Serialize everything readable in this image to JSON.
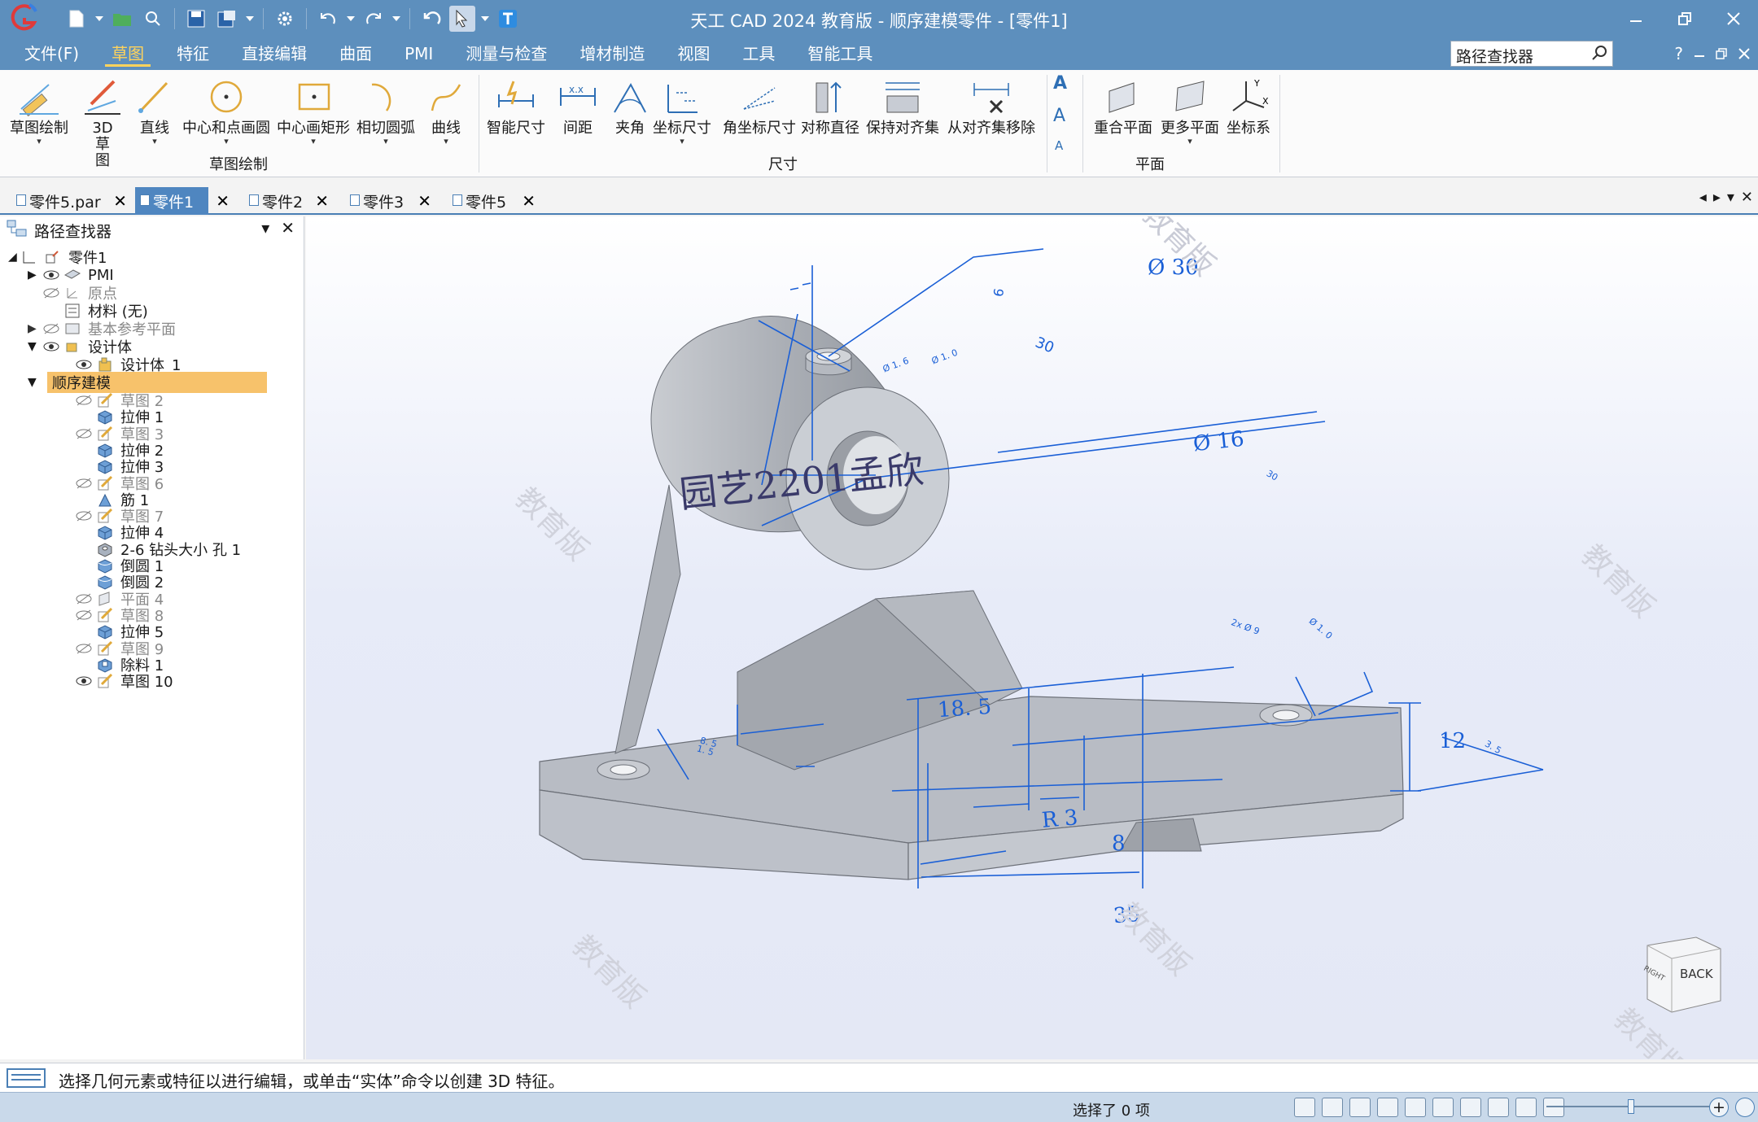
{
  "window": {
    "title": "天工 CAD 2024 教育版 - 顺序建模零件 - [零件1]",
    "accent": "#5d8fbd",
    "controls": [
      "minimize",
      "restore",
      "close"
    ]
  },
  "menubar": {
    "items": [
      "文件(F)",
      "草图",
      "特征",
      "直接编辑",
      "曲面",
      "PMI",
      "测量与检查",
      "增材制造",
      "视图",
      "工具",
      "智能工具"
    ],
    "active_index": 1,
    "search_value": "路径查找器",
    "help": "?"
  },
  "ribbon": {
    "groups": [
      {
        "title": "草图绘制",
        "buttons": [
          "草图绘制",
          "3D 草图",
          "直线",
          "中心和点画圆",
          "中心画矩形",
          "相切圆弧",
          "曲线"
        ]
      },
      {
        "title": "尺寸",
        "buttons": [
          "智能尺寸",
          "间距",
          "夹角",
          "坐标尺寸",
          "角坐标尺寸",
          "对称直径",
          "保持对齐集",
          "从对齐集移除"
        ]
      },
      {
        "title": "平面",
        "buttons": [
          "重合平面",
          "更多平面",
          "坐标系"
        ]
      }
    ],
    "text_buttons": [
      "A",
      "A",
      "A"
    ]
  },
  "tabs": {
    "items": [
      "零件5.par",
      "零件1",
      "零件2",
      "零件3",
      "零件5"
    ],
    "active_index": 1
  },
  "pathfinder": {
    "title": "路径查找器",
    "tree": [
      {
        "label": "零件1",
        "level": 0
      },
      {
        "label": "PMI",
        "level": 1
      },
      {
        "label": "原点",
        "level": 1
      },
      {
        "label": "材料 (无)",
        "level": 1
      },
      {
        "label": "基本参考平面",
        "level": 1
      },
      {
        "label": "设计体",
        "level": 1
      },
      {
        "label": "设计体_1",
        "level": 2
      },
      {
        "label": "顺序建模",
        "level": 1
      },
      {
        "label": "草图 2",
        "level": 2
      },
      {
        "label": "拉伸 1",
        "level": 2
      },
      {
        "label": "草图 3",
        "level": 2
      },
      {
        "label": "拉伸 2",
        "level": 2
      },
      {
        "label": "拉伸 3",
        "level": 2
      },
      {
        "label": "草图 6",
        "level": 2
      },
      {
        "label": "筋 1",
        "level": 2
      },
      {
        "label": "草图 7",
        "level": 2
      },
      {
        "label": "拉伸 4",
        "level": 2
      },
      {
        "label": "2-6 钻头大小 孔 1",
        "level": 2
      },
      {
        "label": "倒圆 1",
        "level": 2
      },
      {
        "label": "倒圆 2",
        "level": 2
      },
      {
        "label": "平面 4",
        "level": 2
      },
      {
        "label": "草图 8",
        "level": 2
      },
      {
        "label": "拉伸 5",
        "level": 2
      },
      {
        "label": "草图 9",
        "level": 2
      },
      {
        "label": "除料 1",
        "level": 2
      },
      {
        "label": "草图 10",
        "level": 2
      }
    ]
  },
  "canvas": {
    "handwriting": "园艺2201孟欣",
    "watermark": "教育版",
    "dims": {
      "d30": "Ø 30",
      "d16": "Ø 16",
      "w30": "30",
      "t6": "6",
      "l185": "18. 5",
      "r3": "R 3",
      "w8": "8",
      "w35": "35",
      "h12": "12",
      "s1": "1. 5",
      "s2": "Ø 1. 6",
      "s3": "Ø 1. 0",
      "s4": "2x Ø 9",
      "s5": "Ø 1. 0",
      "s6": "8. 5",
      "s7": "30",
      "s8": "3. 5"
    },
    "view_cube": {
      "face": "BACK",
      "side": "RIGHT"
    }
  },
  "prompt": {
    "text": "选择几何元素或特征以进行编辑，或单击“实体”命令以创建 3D 特征。"
  },
  "status": {
    "selection": "选择了 0 项"
  }
}
